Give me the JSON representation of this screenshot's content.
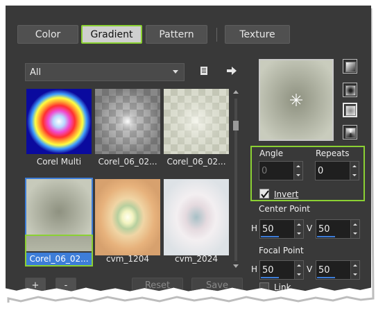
{
  "tabs": [
    {
      "label": "Color",
      "active": false
    },
    {
      "label": "Gradient",
      "active": true
    },
    {
      "label": "Pattern",
      "active": false
    },
    {
      "label": "Texture",
      "active": false
    }
  ],
  "library": {
    "dropdown_value": "All",
    "thumbnails": [
      {
        "label": "Corel Multi",
        "selected": false
      },
      {
        "label": "Corel_06_02...",
        "selected": false
      },
      {
        "label": "Corel_06_02...",
        "selected": false
      },
      {
        "label": "Corel_06_02...",
        "selected": true
      },
      {
        "label": "cvm_1204",
        "selected": false
      },
      {
        "label": "cvm_2024",
        "selected": false
      }
    ]
  },
  "buttons": {
    "add": "+",
    "remove": "-",
    "reset": "Reset",
    "save": "Save"
  },
  "settings": {
    "angle_label": "Angle",
    "angle_value": "0",
    "repeats_label": "Repeats",
    "repeats_value": "0",
    "invert_label": "Invert",
    "invert_checked": true,
    "center_point_label": "Center Point",
    "center_h_label": "H",
    "center_h_value": "50",
    "center_v_label": "V",
    "center_v_value": "50",
    "focal_point_label": "Focal Point",
    "focal_h_label": "H",
    "focal_h_value": "50",
    "focal_v_label": "V",
    "focal_v_value": "50",
    "link_label": "Link",
    "link_checked": false
  },
  "colors": {
    "panel_bg": "#393939",
    "highlight_green": "#8bd133",
    "selection_blue": "#3d7dd8"
  }
}
